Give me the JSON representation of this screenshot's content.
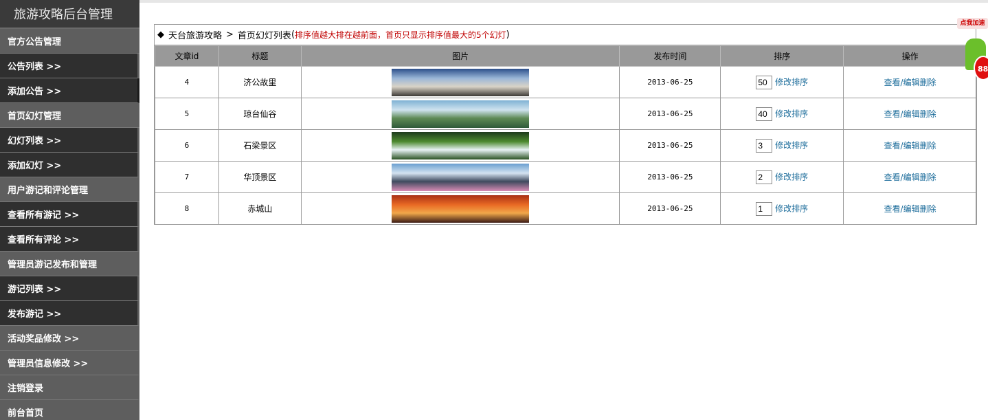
{
  "sidebar": {
    "title": "旅游攻略后台管理",
    "items": [
      {
        "label": "官方公告管理",
        "type": "group"
      },
      {
        "label": "公告列表 >>",
        "type": "link"
      },
      {
        "label": "添加公告 >>",
        "type": "link"
      },
      {
        "label": "首页幻灯管理",
        "type": "group"
      },
      {
        "label": "幻灯列表 >>",
        "type": "link"
      },
      {
        "label": "添加幻灯 >>",
        "type": "link"
      },
      {
        "label": "用户游记和评论管理",
        "type": "group"
      },
      {
        "label": "查看所有游记 >>",
        "type": "link"
      },
      {
        "label": "查看所有评论 >>",
        "type": "link"
      },
      {
        "label": "管理员游记发布和管理",
        "type": "group"
      },
      {
        "label": "游记列表 >>",
        "type": "link"
      },
      {
        "label": "发布游记 >>",
        "type": "link"
      },
      {
        "label": "活动奖品修改 >>",
        "type": "link-alt"
      },
      {
        "label": "管理员信息修改 >>",
        "type": "link-alt"
      },
      {
        "label": "注销登录",
        "type": "link-alt"
      },
      {
        "label": "前台首页",
        "type": "link-alt"
      }
    ]
  },
  "breadcrumb": {
    "diamond": "◆",
    "root": "天台旅游攻略",
    "sep": ">",
    "current": "首页幻灯列表",
    "note_open": "(",
    "note": "排序值越大排在越前面，首页只显示排序值最大的5个幻灯",
    "note_close": ")"
  },
  "table": {
    "headers": [
      "文章id",
      "标题",
      "图片",
      "发布时间",
      "排序",
      "操作"
    ],
    "rows": [
      {
        "id": "4",
        "title": "济公故里",
        "date": "2013-06-25",
        "order": "50",
        "image": "temple-scene",
        "colors": [
          "#2c4f8a",
          "#9bb7d8",
          "#d9d3c7",
          "#3d3a36"
        ]
      },
      {
        "id": "5",
        "title": "琼台仙谷",
        "date": "2013-06-25",
        "order": "40",
        "image": "valley-lake-scene",
        "colors": [
          "#7fb2d4",
          "#cfe3ee",
          "#5e8a55",
          "#2f5a3a"
        ]
      },
      {
        "id": "6",
        "title": "石梁景区",
        "date": "2013-06-25",
        "order": "3",
        "image": "waterfall-scene",
        "colors": [
          "#1e3a1c",
          "#4d8a2e",
          "#e8f2f4",
          "#2a5222"
        ]
      },
      {
        "id": "7",
        "title": "华顶景区",
        "date": "2013-06-25",
        "order": "2",
        "image": "flower-mountain-scene",
        "colors": [
          "#6a9fd0",
          "#d4e3f1",
          "#3f4a5e",
          "#d88bb5"
        ]
      },
      {
        "id": "8",
        "title": "赤城山",
        "date": "2013-06-25",
        "order": "1",
        "image": "sunset-mountain-scene",
        "colors": [
          "#a82f14",
          "#e96a24",
          "#f1a74a",
          "#3a1a14"
        ]
      }
    ],
    "edit_order_label": "修改排序",
    "action_label": "查看/编辑删除"
  },
  "float_badge": {
    "tag": "点我加速",
    "count": "88"
  }
}
